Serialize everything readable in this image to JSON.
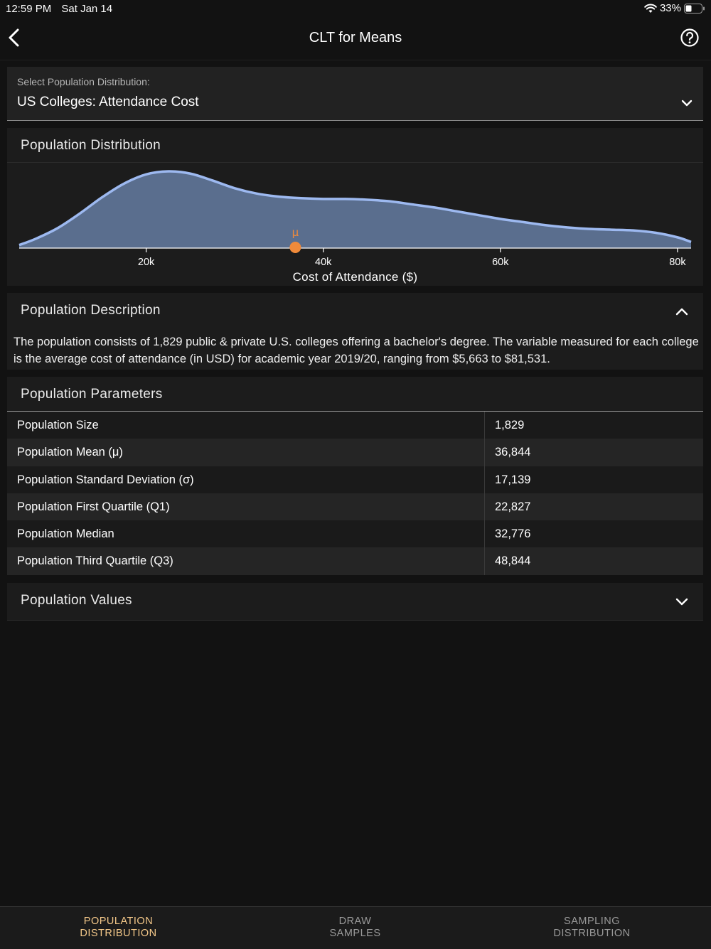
{
  "status_bar": {
    "time": "12:59 PM",
    "date": "Sat Jan 14",
    "battery": "33%"
  },
  "header": {
    "title": "CLT for Means"
  },
  "population_select": {
    "label": "Select Population Distribution:",
    "value": "US Colleges: Attendance Cost"
  },
  "distribution_card": {
    "title": "Population Distribution",
    "chart_data": {
      "type": "area",
      "title": "",
      "xlabel": "Cost of Attendance ($)",
      "ylabel": "",
      "x_ticks": [
        "20k",
        "40k",
        "60k",
        "80k"
      ],
      "x_tick_values": [
        20000,
        40000,
        60000,
        80000
      ],
      "xlim": [
        5663,
        81531
      ],
      "mean_marker": {
        "label": "μ",
        "x": 36844
      },
      "x": [
        5663,
        7500,
        10000,
        12500,
        15000,
        17500,
        20000,
        22500,
        25000,
        27500,
        30000,
        32500,
        35000,
        37500,
        40000,
        42500,
        45000,
        47500,
        50000,
        52500,
        55000,
        57500,
        60000,
        62500,
        65000,
        67500,
        70000,
        72500,
        75000,
        77500,
        80000,
        81531
      ],
      "y": [
        0.04,
        0.12,
        0.26,
        0.45,
        0.66,
        0.84,
        0.96,
        1.0,
        0.97,
        0.88,
        0.78,
        0.71,
        0.67,
        0.65,
        0.64,
        0.64,
        0.63,
        0.61,
        0.57,
        0.53,
        0.48,
        0.43,
        0.38,
        0.34,
        0.3,
        0.27,
        0.25,
        0.24,
        0.23,
        0.2,
        0.14,
        0.08
      ],
      "series": [
        {
          "values_ref": "y"
        }
      ],
      "colors": {
        "fill": "#5a6e8e",
        "line": "#9db9f0",
        "marker": "#f08a3a",
        "axis": "#ffffff"
      }
    }
  },
  "description_card": {
    "title": "Population Description",
    "text": "The population consists of 1,829 public & private U.S. colleges offering a bachelor's degree. The variable measured for each college is the average cost of attendance (in USD) for academic year 2019/20, ranging from $5,663 to $81,531."
  },
  "parameters_card": {
    "title": "Population Parameters",
    "rows": [
      {
        "name": "Population Size",
        "value": "1,829"
      },
      {
        "name": "Population Mean (μ)",
        "value": "36,844"
      },
      {
        "name": "Population Standard Deviation (σ)",
        "value": "17,139"
      },
      {
        "name": "Population First Quartile (Q1)",
        "value": "22,827"
      },
      {
        "name": "Population Median",
        "value": "32,776"
      },
      {
        "name": "Population Third Quartile (Q3)",
        "value": "48,844"
      }
    ]
  },
  "values_card": {
    "title": "Population Values"
  },
  "tabs": [
    {
      "line1": "POPULATION",
      "line2": "DISTRIBUTION",
      "active": true
    },
    {
      "line1": "DRAW",
      "line2": "SAMPLES",
      "active": false
    },
    {
      "line1": "SAMPLING",
      "line2": "DISTRIBUTION",
      "active": false
    }
  ]
}
